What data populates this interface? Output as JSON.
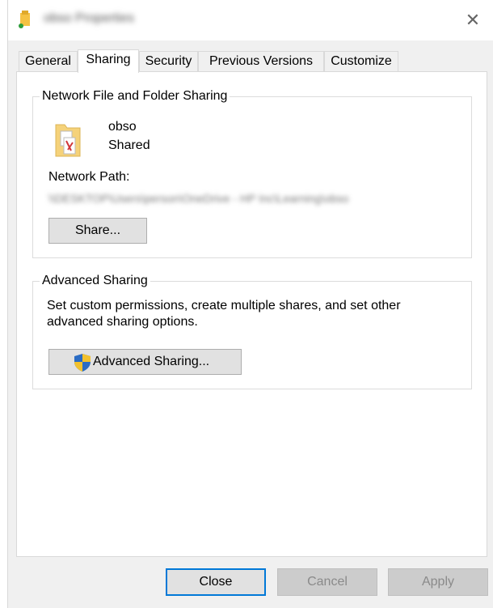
{
  "window": {
    "title": "obso Properties",
    "close_glyph": "✕"
  },
  "tabs": [
    {
      "label": "General"
    },
    {
      "label": "Sharing"
    },
    {
      "label": "Security"
    },
    {
      "label": "Previous Versions"
    },
    {
      "label": "Customize"
    }
  ],
  "network_sharing": {
    "group_label": "Network File and Folder Sharing",
    "folder_name": "obso",
    "folder_status": "Shared",
    "network_path_label": "Network Path:",
    "network_path_value": "\\\\DESKTOP\\Users\\person\\OneDrive - HP Inc\\Learning\\obso",
    "share_button": "Share..."
  },
  "advanced_sharing": {
    "group_label": "Advanced Sharing",
    "description_line1": "Set custom permissions, create multiple shares, and set other",
    "description_line2": "advanced sharing options.",
    "button": "Advanced Sharing..."
  },
  "footer": {
    "close": "Close",
    "cancel": "Cancel",
    "apply": "Apply"
  },
  "icons": {
    "title": "folder-icon",
    "folder": "shared-folder-icon",
    "shield": "uac-shield-icon"
  },
  "colors": {
    "accent": "#0078d7",
    "shield_blue": "#2b6cc4",
    "shield_yellow": "#f2c12e",
    "folder": "#f5d27a"
  }
}
